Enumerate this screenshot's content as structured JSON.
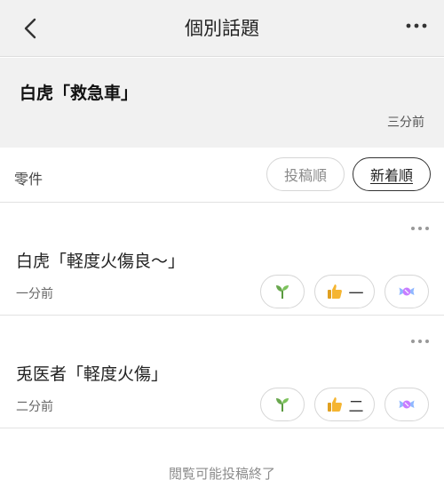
{
  "header": {
    "title": "個別話題",
    "back_icon": "chevron-left-icon",
    "more_icon": "more-horizontal-icon"
  },
  "topic": {
    "title": "白虎「救急車」",
    "time": "三分前"
  },
  "filter": {
    "count_label": "零件",
    "sort_post_label": "投稿順",
    "sort_new_label": "新着順",
    "active": "新着順"
  },
  "posts": [
    {
      "text": "白虎「軽度火傷良〜」",
      "time": "一分前",
      "reactions": [
        {
          "icon": "sprout-icon",
          "count": ""
        },
        {
          "icon": "thumbs-up-icon",
          "count": "一"
        },
        {
          "icon": "candy-icon",
          "count": ""
        }
      ]
    },
    {
      "text": "兎医者「軽度火傷」",
      "time": "二分前",
      "reactions": [
        {
          "icon": "sprout-icon",
          "count": ""
        },
        {
          "icon": "thumbs-up-icon",
          "count": "二"
        },
        {
          "icon": "candy-icon",
          "count": ""
        }
      ]
    }
  ],
  "footer": {
    "end_text": "閲覧可能投稿終了"
  },
  "colors": {
    "header_bg": "#f1f1f1",
    "sprout": "#6aa84f",
    "thumb": "#f5b531",
    "candy": "#c77dff"
  }
}
